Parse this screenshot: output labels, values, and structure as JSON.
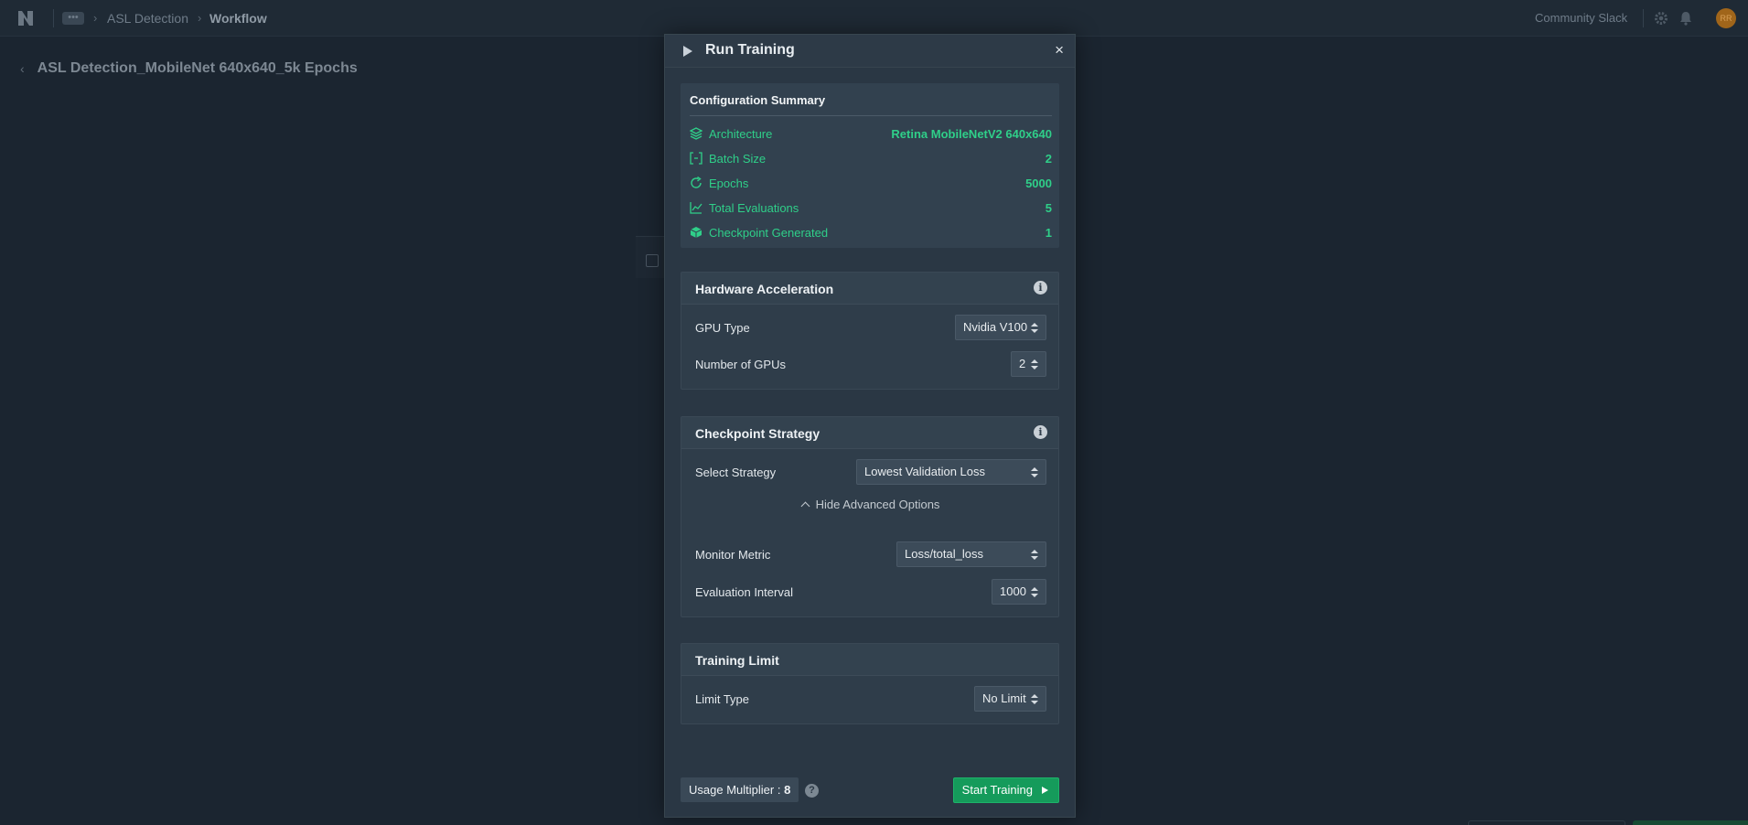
{
  "topbar": {
    "breadcrumb_dots": "•••",
    "breadcrumb": [
      "ASL Detection",
      "Workflow"
    ],
    "community_link": "Community Slack",
    "avatar_initials": "RR"
  },
  "page": {
    "title": "ASL Detection_MobileNet 640x640_5k Epochs"
  },
  "modal": {
    "title": "Run Training",
    "close": "×",
    "summary": {
      "title": "Configuration Summary",
      "rows": [
        {
          "label": "Architecture",
          "value": "Retina MobileNetV2 640x640",
          "icon": "layers-icon"
        },
        {
          "label": "Batch Size",
          "value": "2",
          "icon": "brackets-icon"
        },
        {
          "label": "Epochs",
          "value": "5000",
          "icon": "refresh-icon"
        },
        {
          "label": "Total Evaluations",
          "value": "5",
          "icon": "chart-icon"
        },
        {
          "label": "Checkpoint Generated",
          "value": "1",
          "icon": "cube-icon"
        }
      ]
    },
    "hardware": {
      "title": "Hardware Acceleration",
      "gpu_type_label": "GPU Type",
      "gpu_type_value": "Nvidia V100",
      "num_gpus_label": "Number of GPUs",
      "num_gpus_value": "2"
    },
    "checkpoint": {
      "title": "Checkpoint Strategy",
      "strategy_label": "Select Strategy",
      "strategy_value": "Lowest Validation Loss",
      "advanced_toggle": "Hide Advanced Options",
      "metric_label": "Monitor Metric",
      "metric_value": "Loss/total_loss",
      "interval_label": "Evaluation Interval",
      "interval_value": "1000"
    },
    "limit": {
      "title": "Training Limit",
      "type_label": "Limit Type",
      "type_value": "No Limit"
    },
    "footer": {
      "usage_label": "Usage Multiplier :",
      "usage_value": "8",
      "help": "?",
      "start_label": "Start Training"
    }
  },
  "colors": {
    "accent_green": "#2fcf89",
    "button_green": "#159b5b",
    "modal_bg": "#2a3744"
  }
}
